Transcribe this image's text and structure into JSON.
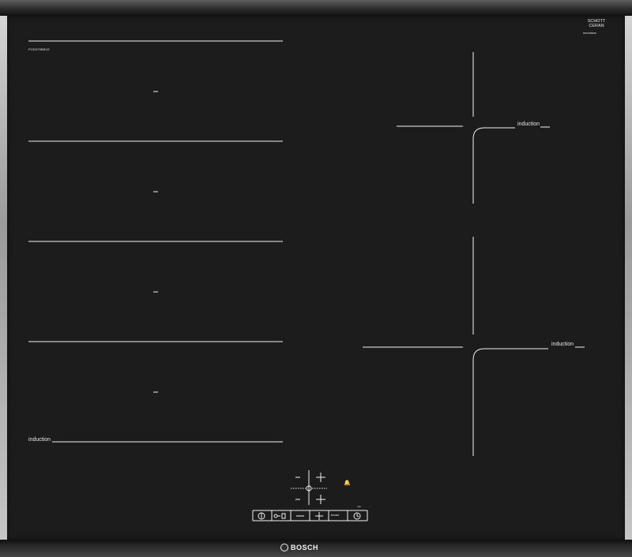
{
  "appliance": {
    "model_code": "PXE675BB1E",
    "glass_brand": [
      "SCHOTT",
      "CERAN"
    ],
    "serial_text": "6001008028",
    "brand_logo": "BOSCH",
    "zone_labels": {
      "flex_zone": "induction",
      "rear_right": "induction",
      "front_right": "induction"
    }
  },
  "controls": {
    "minus_top": "–",
    "plus_top": "+",
    "minus_bottom": "–",
    "plus_bottom": "+",
    "bell_icon": "bell-icon",
    "timer_label": "min",
    "power_icon": "power-icon",
    "lock_icon": "lock-icon",
    "minus_main": "–",
    "plus_main": "+",
    "boost_label": "boost",
    "clock_icon": "clock-icon"
  }
}
